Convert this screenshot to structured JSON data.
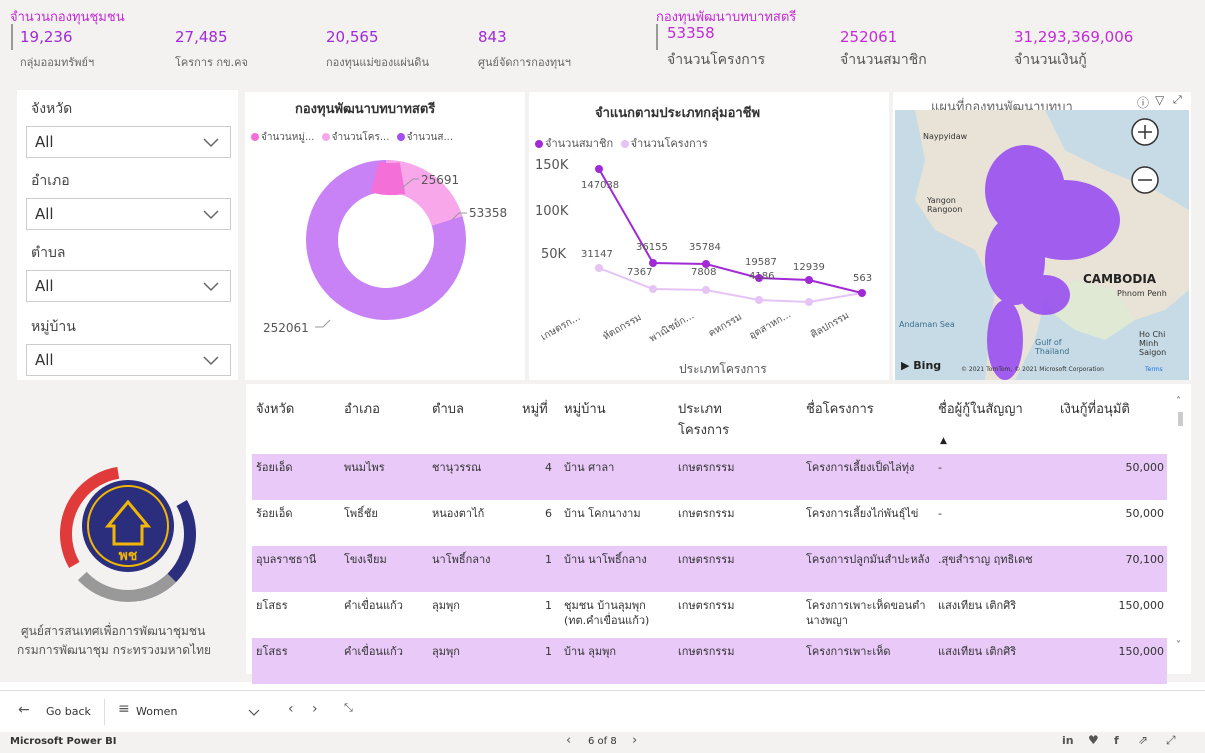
{
  "kpi": {
    "left_title": "จำนวนกองทุนชุมชน",
    "right_title": "กองทุนพัฒนาบทบาทสตรี",
    "cards": [
      {
        "value": "19,236",
        "label": "กลุ่มออมทรัพย์ฯ"
      },
      {
        "value": "27,485",
        "label": "โครการ กข.คจ"
      },
      {
        "value": "20,565",
        "label": "กองทุนแม่ของแผ่นดิน"
      },
      {
        "value": "843",
        "label": "ศูนย์จัดการกองทุนฯ"
      },
      {
        "value": "53358",
        "label": "จำนวนโครงการ"
      },
      {
        "value": "252061",
        "label": "จำนวนสมาชิก"
      },
      {
        "value": "31,293,369,006",
        "label": "จำนวนเงินกู้"
      }
    ]
  },
  "slicers": [
    {
      "title": "จังหวัด",
      "value": "All"
    },
    {
      "title": "อำเภอ",
      "value": "All"
    },
    {
      "title": "ตำบล",
      "value": "All"
    },
    {
      "title": "หมู่บ้าน",
      "value": "All"
    }
  ],
  "donut": {
    "title": "กองทุนพัฒนาบทบาทสตรี",
    "legend": [
      "จำนวนหมู่...",
      "จำนวนโคร...",
      "จำนวนส..."
    ],
    "labels": [
      "25691",
      "53358",
      "252061"
    ]
  },
  "line": {
    "title": "จำแนกตามประเภทกลุ่มอาชีพ",
    "legend": [
      "จำนวนสมาชิก",
      "จำนวนโครงการ"
    ],
    "xlabel": "ประเภทโครงการ",
    "yticks": [
      "150K",
      "100K",
      "50K"
    ],
    "categories": [
      "เกษตรก...",
      "หัตถกรรม",
      "พาณิชย์ก...",
      "คหกรรม",
      "อุตสาหก...",
      "ศิลปกรรม"
    ],
    "members_labels": [
      "147038",
      "36155",
      "35784",
      "19587",
      "12939",
      "563"
    ],
    "projects_labels": [
      "31147",
      "7367",
      "7808",
      "4186"
    ]
  },
  "map": {
    "title": "แผนที่กองทุนพัฒนาบทบา",
    "places": [
      "Naypyidaw",
      "Yangon Rangoon",
      "CAMBODIA",
      "Phnom Penh",
      "Andaman Sea",
      "Ho Chi Minh Saigon",
      "Gulf of Thailand"
    ],
    "bing": "Bing",
    "copyright": "© 2021 TomTom, © 2021 Microsoft Corporation",
    "terms": "Terms"
  },
  "org": {
    "line1": "ศูนย์สารสนเทศเพื่อการพัฒนาชุมชน",
    "line2": "กรมการพัฒนาชุม กระทรวงมหาดไทย",
    "logo_text": "พช"
  },
  "table": {
    "headers": [
      "จังหวัด",
      "อำเภอ",
      "ตำบล",
      "หมู่ที่",
      "หมู่บ้าน",
      "ประเภท โครงการ",
      "ชื่อโครงการ",
      "ชื่อผู้กู้ในสัญญา",
      "เงินกู้ที่อนุมัติ"
    ],
    "rows": [
      [
        "ร้อยเอ็ด",
        "พนมไพร",
        "ชานุวรรณ",
        "4",
        "บ้าน ศาลา",
        "เกษตรกรรม",
        "โครงการเลี้ยงเป็ดไล่ทุ่ง",
        "-",
        "50,000"
      ],
      [
        "ร้อยเอ็ด",
        "โพธิ์ชัย",
        "หนองตาไก้",
        "6",
        "บ้าน โคกนางาม",
        "เกษตรกรรม",
        "โครงการเลี้ยงไก่พันธุ์ไข่",
        "-",
        "50,000"
      ],
      [
        "อุบลราชธานี",
        "โขงเจียม",
        "นาโพธิ์กลาง",
        "1",
        "บ้าน นาโพธิ์กลาง",
        "เกษตรกรรม",
        "โครงการปลูกมันสำปะหลัง",
        ".สุขสำราญ ฤทธิเดช",
        "70,100"
      ],
      [
        "ยโสธร",
        "คำเขื่อนแก้ว",
        "ลุมพุก",
        "1",
        "ชุมชน บ้านลุมพุก (ทต.คำเขื่อนแก้ว)",
        "เกษตรกรรม",
        "โครงการเพาะเห็ดขอนตำนางพญา",
        "แสงเทียน เติกศิริ",
        "150,000"
      ],
      [
        "ยโสธร",
        "คำเขื่อนแก้ว",
        "ลุมพุก",
        "1",
        "บ้าน ลุมพุก",
        "เกษตรกรรม",
        "โครงการเพาะเห็ด",
        "แสงเทียน เติกศิริ",
        "150,000"
      ]
    ]
  },
  "nav": {
    "back": "Go back",
    "bookmark": "Women",
    "page": "6 of 8",
    "brand": "Microsoft Power BI"
  },
  "colors": {
    "accent": "#a12ad6",
    "row_highlight": "#e8c9f7"
  }
}
